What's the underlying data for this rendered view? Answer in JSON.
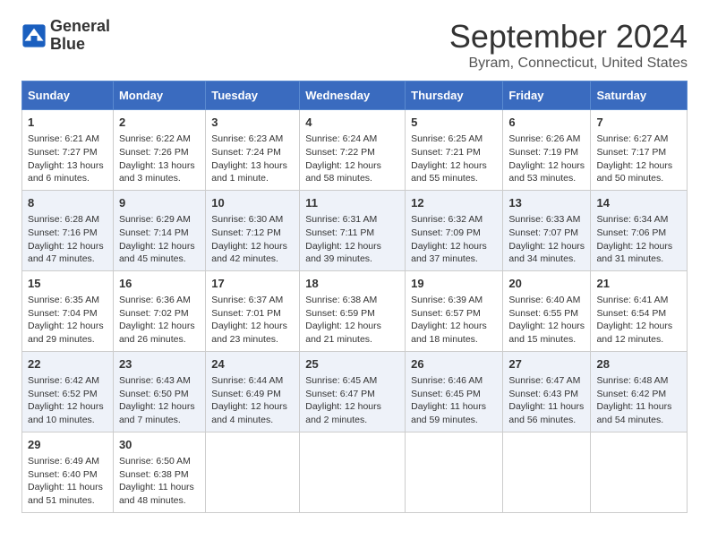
{
  "header": {
    "logo_line1": "General",
    "logo_line2": "Blue",
    "month": "September 2024",
    "location": "Byram, Connecticut, United States"
  },
  "weekdays": [
    "Sunday",
    "Monday",
    "Tuesday",
    "Wednesday",
    "Thursday",
    "Friday",
    "Saturday"
  ],
  "weeks": [
    [
      {
        "day": "1",
        "info": "Sunrise: 6:21 AM\nSunset: 7:27 PM\nDaylight: 13 hours and 6 minutes."
      },
      {
        "day": "2",
        "info": "Sunrise: 6:22 AM\nSunset: 7:26 PM\nDaylight: 13 hours and 3 minutes."
      },
      {
        "day": "3",
        "info": "Sunrise: 6:23 AM\nSunset: 7:24 PM\nDaylight: 13 hours and 1 minute."
      },
      {
        "day": "4",
        "info": "Sunrise: 6:24 AM\nSunset: 7:22 PM\nDaylight: 12 hours and 58 minutes."
      },
      {
        "day": "5",
        "info": "Sunrise: 6:25 AM\nSunset: 7:21 PM\nDaylight: 12 hours and 55 minutes."
      },
      {
        "day": "6",
        "info": "Sunrise: 6:26 AM\nSunset: 7:19 PM\nDaylight: 12 hours and 53 minutes."
      },
      {
        "day": "7",
        "info": "Sunrise: 6:27 AM\nSunset: 7:17 PM\nDaylight: 12 hours and 50 minutes."
      }
    ],
    [
      {
        "day": "8",
        "info": "Sunrise: 6:28 AM\nSunset: 7:16 PM\nDaylight: 12 hours and 47 minutes."
      },
      {
        "day": "9",
        "info": "Sunrise: 6:29 AM\nSunset: 7:14 PM\nDaylight: 12 hours and 45 minutes."
      },
      {
        "day": "10",
        "info": "Sunrise: 6:30 AM\nSunset: 7:12 PM\nDaylight: 12 hours and 42 minutes."
      },
      {
        "day": "11",
        "info": "Sunrise: 6:31 AM\nSunset: 7:11 PM\nDaylight: 12 hours and 39 minutes."
      },
      {
        "day": "12",
        "info": "Sunrise: 6:32 AM\nSunset: 7:09 PM\nDaylight: 12 hours and 37 minutes."
      },
      {
        "day": "13",
        "info": "Sunrise: 6:33 AM\nSunset: 7:07 PM\nDaylight: 12 hours and 34 minutes."
      },
      {
        "day": "14",
        "info": "Sunrise: 6:34 AM\nSunset: 7:06 PM\nDaylight: 12 hours and 31 minutes."
      }
    ],
    [
      {
        "day": "15",
        "info": "Sunrise: 6:35 AM\nSunset: 7:04 PM\nDaylight: 12 hours and 29 minutes."
      },
      {
        "day": "16",
        "info": "Sunrise: 6:36 AM\nSunset: 7:02 PM\nDaylight: 12 hours and 26 minutes."
      },
      {
        "day": "17",
        "info": "Sunrise: 6:37 AM\nSunset: 7:01 PM\nDaylight: 12 hours and 23 minutes."
      },
      {
        "day": "18",
        "info": "Sunrise: 6:38 AM\nSunset: 6:59 PM\nDaylight: 12 hours and 21 minutes."
      },
      {
        "day": "19",
        "info": "Sunrise: 6:39 AM\nSunset: 6:57 PM\nDaylight: 12 hours and 18 minutes."
      },
      {
        "day": "20",
        "info": "Sunrise: 6:40 AM\nSunset: 6:55 PM\nDaylight: 12 hours and 15 minutes."
      },
      {
        "day": "21",
        "info": "Sunrise: 6:41 AM\nSunset: 6:54 PM\nDaylight: 12 hours and 12 minutes."
      }
    ],
    [
      {
        "day": "22",
        "info": "Sunrise: 6:42 AM\nSunset: 6:52 PM\nDaylight: 12 hours and 10 minutes."
      },
      {
        "day": "23",
        "info": "Sunrise: 6:43 AM\nSunset: 6:50 PM\nDaylight: 12 hours and 7 minutes."
      },
      {
        "day": "24",
        "info": "Sunrise: 6:44 AM\nSunset: 6:49 PM\nDaylight: 12 hours and 4 minutes."
      },
      {
        "day": "25",
        "info": "Sunrise: 6:45 AM\nSunset: 6:47 PM\nDaylight: 12 hours and 2 minutes."
      },
      {
        "day": "26",
        "info": "Sunrise: 6:46 AM\nSunset: 6:45 PM\nDaylight: 11 hours and 59 minutes."
      },
      {
        "day": "27",
        "info": "Sunrise: 6:47 AM\nSunset: 6:43 PM\nDaylight: 11 hours and 56 minutes."
      },
      {
        "day": "28",
        "info": "Sunrise: 6:48 AM\nSunset: 6:42 PM\nDaylight: 11 hours and 54 minutes."
      }
    ],
    [
      {
        "day": "29",
        "info": "Sunrise: 6:49 AM\nSunset: 6:40 PM\nDaylight: 11 hours and 51 minutes."
      },
      {
        "day": "30",
        "info": "Sunrise: 6:50 AM\nSunset: 6:38 PM\nDaylight: 11 hours and 48 minutes."
      },
      {
        "day": "",
        "info": ""
      },
      {
        "day": "",
        "info": ""
      },
      {
        "day": "",
        "info": ""
      },
      {
        "day": "",
        "info": ""
      },
      {
        "day": "",
        "info": ""
      }
    ]
  ]
}
